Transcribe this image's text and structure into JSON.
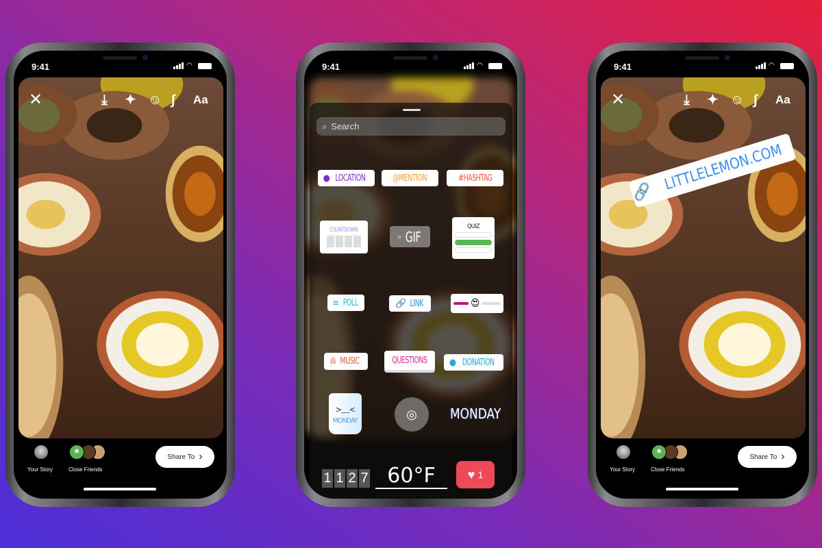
{
  "status_bar": {
    "time": "9:41"
  },
  "toolbar": {
    "close_icon": "close-icon",
    "download_icon": "download-icon",
    "effects_icon": "sparkles-icon",
    "sticker_icon": "sticker-icon",
    "draw_icon": "draw-squiggle-icon",
    "text_label": "Aa"
  },
  "bottom_bar": {
    "your_story": "Your Story",
    "close_friends": "Close Friends",
    "share_to": "Share To",
    "share_chevron": "›"
  },
  "sticker_tray": {
    "search_placeholder": "Search",
    "location": "LOCATION",
    "mention": "@MENTION",
    "hashtag": "#HASHTAG",
    "countdown": "COUNTDOWN",
    "gif": "GIF",
    "quiz": "QUIZ",
    "poll": "POLL",
    "link": "LINK",
    "slider_emoji": "😍",
    "music": "MUSIC",
    "questions": "QUESTIONS",
    "donation": "DONATION",
    "mug_text": "MONDAY",
    "day_sticker": "MONDAY",
    "clock": [
      "1",
      "1",
      "2",
      "7"
    ],
    "temperature": "60°F",
    "likes": "1"
  },
  "link_sticker": {
    "text": "LITTLELEMON.COM"
  },
  "colors": {
    "quiz_correct": "#5ab552",
    "likes_badge": "#ed4956",
    "share_button": "#ffffff",
    "link_blue": "#3a8ef0"
  }
}
